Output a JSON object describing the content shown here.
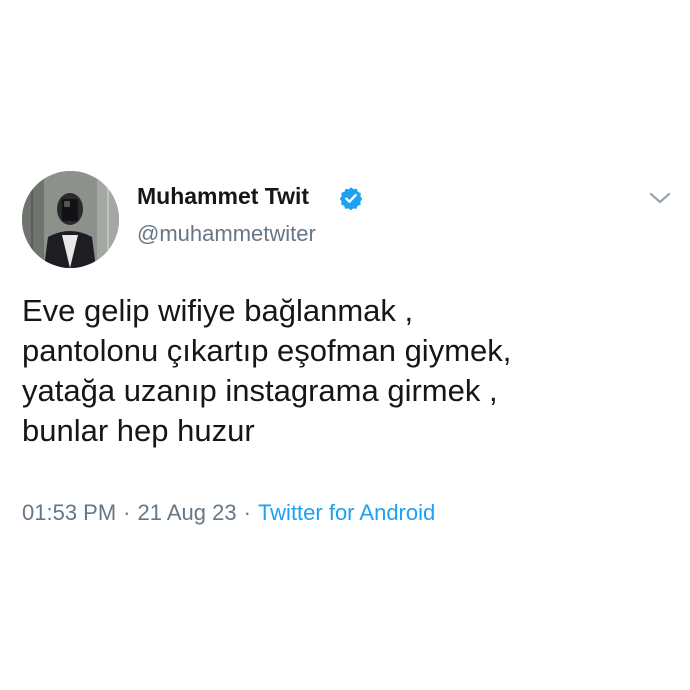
{
  "user": {
    "display_name": "Muhammet Twit",
    "handle": "@muhammetwiter",
    "verified": true,
    "verified_color": "#1da1f2"
  },
  "tweet": {
    "lines": [
      "Eve gelip wifiye bağlanmak ,",
      "pantolonu çıkartıp eşofman giymek,",
      "yatağa uzanıp instagrama girmek ,",
      "bunlar hep huzur"
    ],
    "time": "01:53 PM",
    "separator": "·",
    "date": "21 Aug 23",
    "source": "Twitter for Android"
  },
  "icons": {
    "verified": "verified-badge-icon",
    "more": "chevron-down-icon"
  },
  "colors": {
    "text": "#14171a",
    "secondary": "#657786",
    "link": "#1da1f2"
  }
}
